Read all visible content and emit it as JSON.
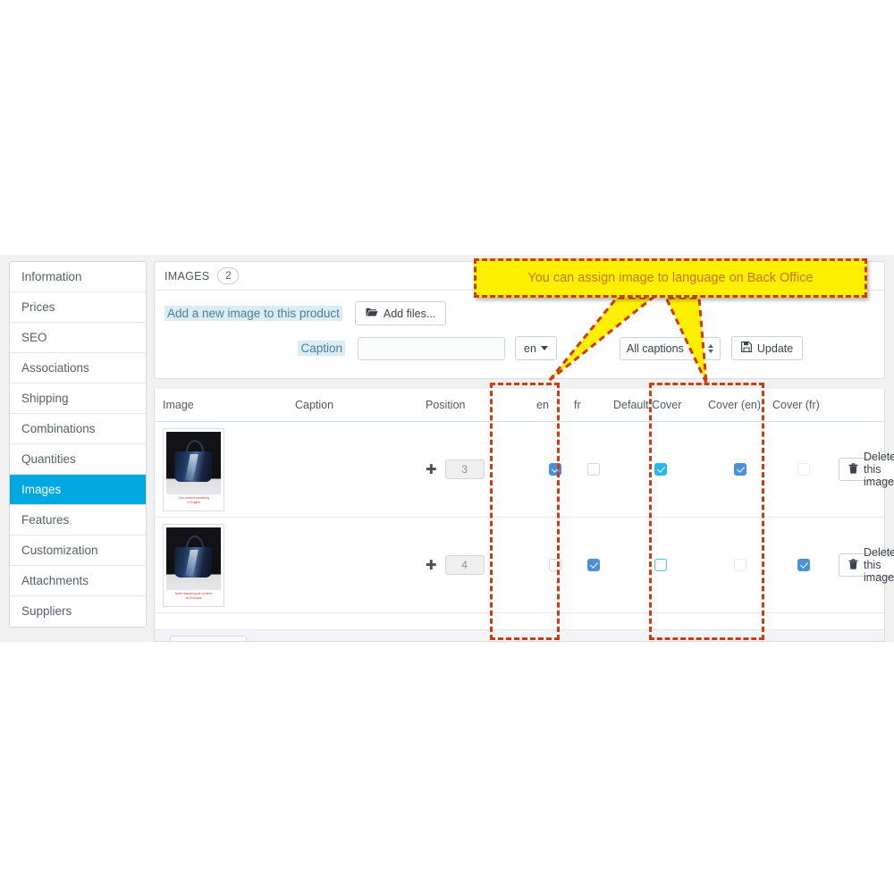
{
  "sidebar": {
    "items": [
      {
        "label": "Information",
        "active": false
      },
      {
        "label": "Prices",
        "active": false
      },
      {
        "label": "SEO",
        "active": false
      },
      {
        "label": "Associations",
        "active": false
      },
      {
        "label": "Shipping",
        "active": false
      },
      {
        "label": "Combinations",
        "active": false
      },
      {
        "label": "Quantities",
        "active": false
      },
      {
        "label": "Images",
        "active": true
      },
      {
        "label": "Features",
        "active": false
      },
      {
        "label": "Customization",
        "active": false
      },
      {
        "label": "Attachments",
        "active": false
      },
      {
        "label": "Suppliers",
        "active": false
      }
    ]
  },
  "panel": {
    "title": "IMAGES",
    "count": "2",
    "add_image_label": "Add a new image to this product",
    "add_files_label": "Add files...",
    "add_files_icon": "folder-open-icon",
    "caption_label": "Caption",
    "caption_value": "",
    "caption_placeholder": "",
    "language_button": "en",
    "language_caret_icon": "caret-down-icon",
    "captions_filter_value": "All captions",
    "update_label": "Update",
    "update_icon": "floppy-save-icon"
  },
  "table": {
    "headers": {
      "image": "Image",
      "caption": "Caption",
      "position": "Position",
      "en": "en",
      "fr": "fr",
      "default_cover": "Default Cover",
      "cover_en": "Cover (en)",
      "cover_fr": "Cover (fr)"
    },
    "rows": [
      {
        "thumb_caption_line1": "Your content marketing",
        "thumb_caption_line2": "in English",
        "caption": "",
        "position": "3",
        "move_icon": "move-arrows-icon",
        "en": true,
        "fr": false,
        "default_cover": true,
        "cover_en": true,
        "cover_fr": false,
        "delete_label": "Delete this image",
        "delete_icon": "trash-icon"
      },
      {
        "thumb_caption_line1": "Notre marketing de contenu",
        "thumb_caption_line2": "en Français",
        "caption": "",
        "position": "4",
        "move_icon": "move-arrows-icon",
        "en": false,
        "fr": true,
        "default_cover": false,
        "cover_en": false,
        "cover_fr": true,
        "delete_label": "Delete this image",
        "delete_icon": "trash-icon"
      }
    ]
  },
  "annotation": {
    "callout_text": "You can assign image to language on Back Office",
    "callout_fill": "#ffef00",
    "callout_border": "#cf3a10",
    "callout_text_color": "#c6761c",
    "highlight_box_color": "#cf3a10"
  },
  "colors": {
    "active_tab": "#00a8e2",
    "checkbox_blue": "#4a90d9",
    "checkbox_cyan": "#29b6e8",
    "link_highlight": "#dcecf4"
  }
}
